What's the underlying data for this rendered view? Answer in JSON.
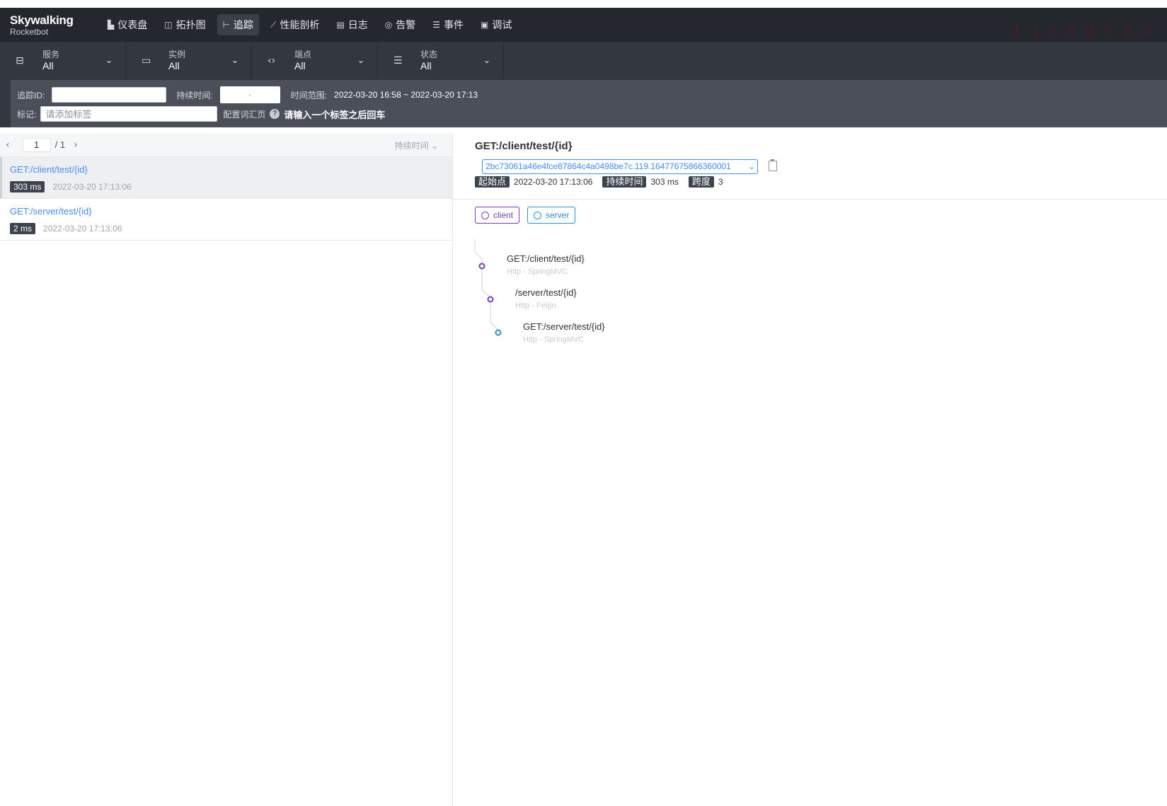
{
  "app": {
    "logo_line1": "Skywalking",
    "logo_line2": "Rocketbot",
    "watermark": "1 1 7 0 8 5 0 V"
  },
  "nav": [
    {
      "icon": "dashboard-icon",
      "glyph": "▙",
      "label": "仪表盘"
    },
    {
      "icon": "topology-icon",
      "glyph": "◫",
      "label": "拓扑图"
    },
    {
      "icon": "trace-icon",
      "glyph": "⊢",
      "label": "追踪"
    },
    {
      "icon": "profile-icon",
      "glyph": "⟋",
      "label": "性能剖析"
    },
    {
      "icon": "log-icon",
      "glyph": "▤",
      "label": "日志"
    },
    {
      "icon": "alarm-icon",
      "glyph": "◎",
      "label": "告警"
    },
    {
      "icon": "event-icon",
      "glyph": "☰",
      "label": "事件"
    },
    {
      "icon": "debug-icon",
      "glyph": "▣",
      "label": "调试"
    }
  ],
  "filters": [
    {
      "label": "服务",
      "value": "All",
      "glyph": "⊟"
    },
    {
      "label": "实例",
      "value": "All",
      "glyph": "▭"
    },
    {
      "label": "端点",
      "value": "All",
      "glyph": "‹›"
    },
    {
      "label": "状态",
      "value": "All",
      "glyph": "☰"
    }
  ],
  "search": {
    "trace_id_label": "追踪ID:",
    "trace_id_value": "",
    "duration_label": "持续时间:",
    "duration_placeholder": "-",
    "time_range_label": "时间范围:",
    "time_range_value": "2022-03-20 16:58 ~ 2022-03-20 17:13",
    "tags_label": "标记:",
    "tags_placeholder": "请添加标签",
    "config_link": "配置词汇页",
    "hint": "请输入一个标签之后回车"
  },
  "list": {
    "page_current": "1",
    "page_total": "/ 1",
    "sort_label": "持续时间",
    "traces": [
      {
        "endpoint": "GET:/client/test/{id}",
        "duration": "303 ms",
        "start": "2022-03-20 17:13:06"
      },
      {
        "endpoint": "GET:/server/test/{id}",
        "duration": "2 ms",
        "start": "2022-03-20 17:13:06"
      }
    ]
  },
  "detail": {
    "title": "GET:/client/test/{id}",
    "trace_id": "2bc73061a46e4fce87864c4a0498be7c.119.16477675866360001",
    "start_label": "起始点",
    "start_value": "2022-03-20 17:13:06",
    "duration_label": "持续时间",
    "duration_value": "303 ms",
    "span_label": "跨度",
    "span_value": "3",
    "legend": [
      {
        "name": "client",
        "color": "#7a3db3"
      },
      {
        "name": "server",
        "color": "#2e8fd1"
      }
    ],
    "spans": [
      {
        "title": "GET:/client/test/{id}",
        "subtitle": "Http - SpringMVC",
        "service": "client"
      },
      {
        "title": "/server/test/{id}",
        "subtitle": "Http - Feign",
        "service": "client"
      },
      {
        "title": "GET:/server/test/{id}",
        "subtitle": "Http - SpringMVC",
        "service": "server"
      }
    ]
  },
  "colors": {
    "accent": "#448dfe",
    "nav_bg": "#24272e",
    "panel_bg": "#33373f",
    "client": "#7a3db3",
    "server": "#2e8fd1"
  }
}
